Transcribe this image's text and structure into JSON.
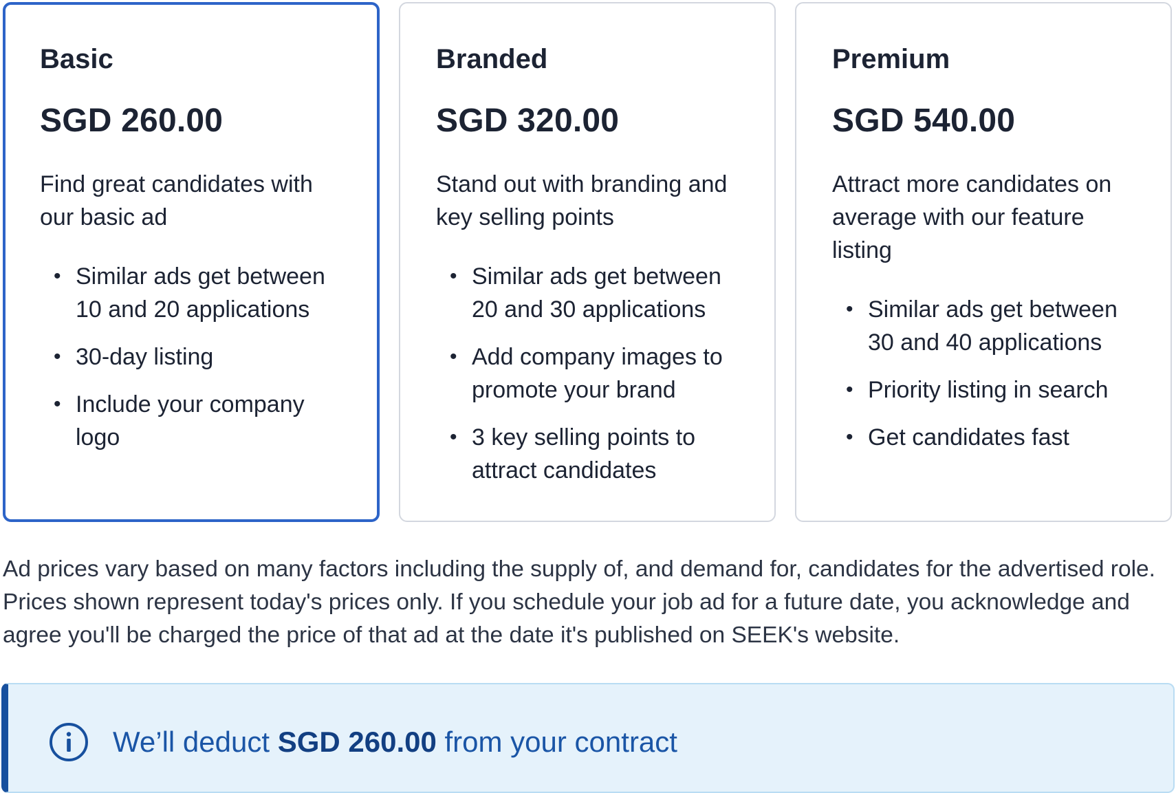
{
  "plans": [
    {
      "title": "Basic",
      "price": "SGD 260.00",
      "description": "Find great candidates with our basic ad",
      "features": [
        "Similar ads get between 10 and 20 applications",
        "30-day listing",
        "Include your company logo"
      ],
      "selected": true
    },
    {
      "title": "Branded",
      "price": "SGD 320.00",
      "description": "Stand out with branding and key selling points",
      "features": [
        "Similar ads get between 20 and 30 applications",
        "Add company images to promote your brand",
        "3 key selling points to attract candidates"
      ],
      "selected": false
    },
    {
      "title": "Premium",
      "price": "SGD 540.00",
      "description": "Attract more candidates on average with our feature listing",
      "features": [
        "Similar ads get between 30 and 40 applications",
        "Priority listing in search",
        "Get candidates fast"
      ],
      "selected": false
    }
  ],
  "disclaimer": "Ad prices vary based on many factors including the supply of, and demand for, candidates for the advertised role. Prices shown represent today's prices only. If you schedule your job ad for a future date, you acknowledge and agree you'll be charged the price of that ad at the date it's published on SEEK's website.",
  "banner": {
    "prefix": "We’ll deduct ",
    "amount": "SGD 260.00",
    "suffix": " from your contract",
    "icon": "info-icon"
  },
  "colors": {
    "selected_border": "#2d64c8",
    "banner_bg": "#e5f2fb",
    "banner_accent": "#17509e",
    "banner_text": "#1a55a6"
  }
}
